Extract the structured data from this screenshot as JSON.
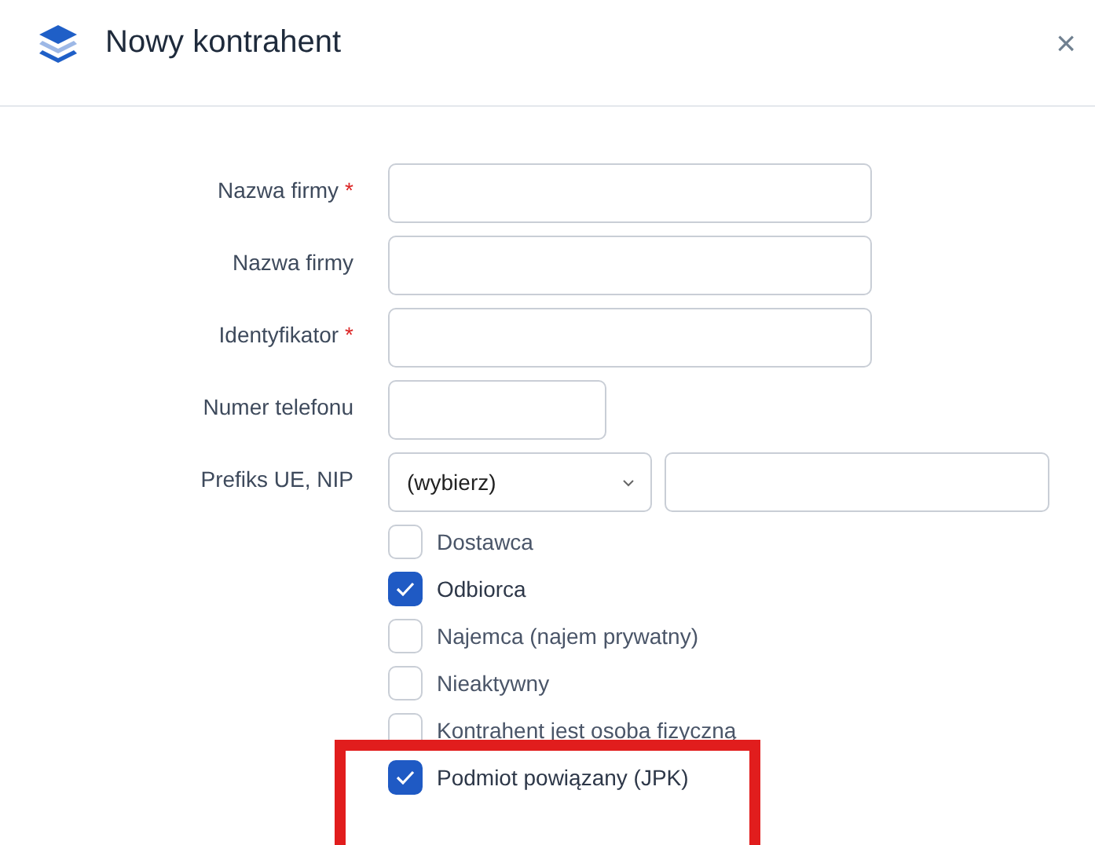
{
  "dialog": {
    "title": "Nowy kontrahent",
    "close": "×"
  },
  "fields": [
    {
      "kind": "text",
      "label": "Nazwa firmy",
      "required_mark": "*"
    },
    {
      "kind": "text",
      "label": "Nazwa firmy"
    },
    {
      "kind": "text",
      "label": "Identyfikator",
      "required_mark": "*"
    },
    {
      "kind": "phone",
      "label": "Numer telefonu"
    },
    {
      "kind": "prefix_nip",
      "label": "Prefiks UE, NIP",
      "select_value": "(wybierz)"
    }
  ],
  "checkboxes": [
    {
      "label": "Dostawca",
      "checked": false,
      "highlighted": false
    },
    {
      "label": "Odbiorca",
      "checked": true,
      "highlighted": false
    },
    {
      "label": "Najemca (najem prywatny)",
      "checked": false,
      "highlighted": false
    },
    {
      "label": "Nieaktywny",
      "checked": false,
      "highlighted": false
    },
    {
      "label": "Kontrahent jest osoba fizyczną",
      "checked": false,
      "highlighted": false
    },
    {
      "label": "Podmiot powiązany (JPK)",
      "checked": true,
      "highlighted": true
    }
  ]
}
